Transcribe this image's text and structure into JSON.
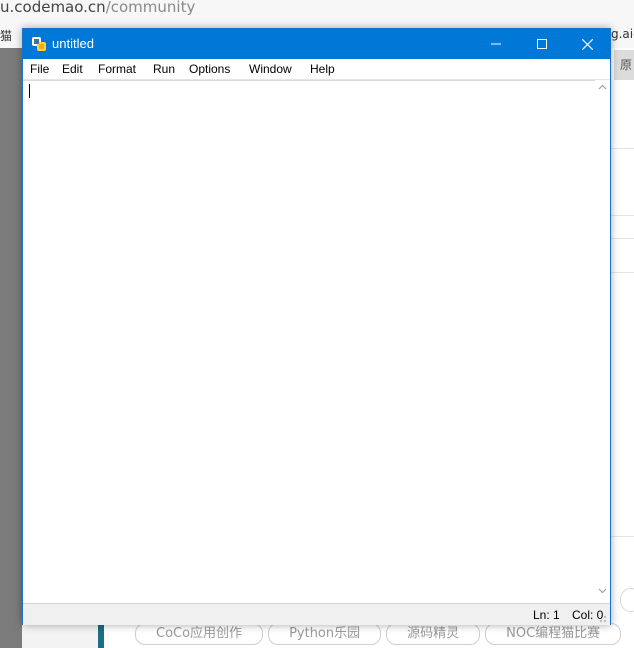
{
  "browser": {
    "url_host": "u.codemao.cn",
    "url_path": "/community",
    "bookmark_left": "猫",
    "bookmark_right": "g.aic",
    "side_chip": "原",
    "tags": [
      "CoCo应用创作",
      "Python乐园",
      "源码精灵",
      "NOC编程猫比赛"
    ]
  },
  "window": {
    "title": "untitled",
    "menu": [
      "File",
      "Edit",
      "Format",
      "Run",
      "Options",
      "Window",
      "Help"
    ],
    "editor_text": "",
    "status": {
      "line": "Ln: 1",
      "col": "Col: 0"
    },
    "colors": {
      "titlebar": "#0078d7",
      "statusbar": "#f0f0f0"
    }
  }
}
